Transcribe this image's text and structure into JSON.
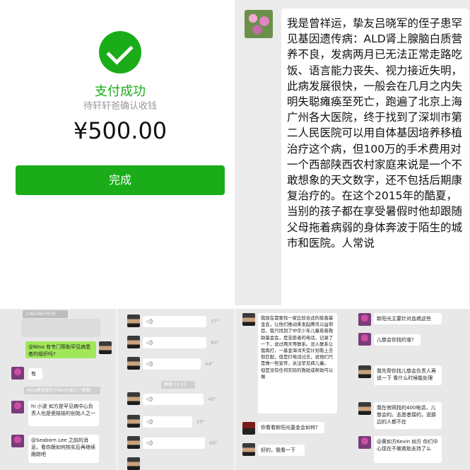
{
  "payment": {
    "title": "支付成功",
    "subtitle": "待轩轩爸确认收钱",
    "amount": "¥500.00",
    "done_label": "完成",
    "accent": "#1aad19"
  },
  "story": {
    "text": "我是曾祥运，挚友吕晓军的侄子患罕见基因遗传病：ALD肾上腺脑白质营养不良，发病两月已无法正常走路吃饭、语言能力丧失、视力接近失明，此病发展很快，一般会在几月之内失明失聪瘫痪至死亡，跑遍了北京上海广州各大医院，终于找到了深圳市第二人民医院可以用自体基因培养移植治疗这个病，但100万的手术费用对一个西部陕西农村家庭来说是一个不敢想象的天文数字，还不包括后期康复治疗的。在这个2015年的酷夏，当别的孩子都在享受暑假时他却跟随父母拖着病弱的身体奔波于陌生的城市和医院。人常说"
  },
  "shot1": {
    "top_number": "13623607679",
    "bubble1": "@Nina 有专门帮助罕见病患者的组织吗?",
    "bubble2": "有",
    "system": "Nina邀请黄轩兰Kevin加入了群聊",
    "bubble3": "hi 小波 如方是罕见病中心负责人也是瓷娃娃的创始人之一",
    "bubble4": "@Seaborn Lee 之前的消息，看你跟如何核实后再继续跟踪吧"
  },
  "shot2": {
    "durations": [
      "57\"",
      "60\"",
      "44\"",
      "48\"",
      "29\"",
      "49\""
    ],
    "system": "晚晚 11:01"
  },
  "shot3": {
    "bubble1": "我现在需要找一家比较合适的慈善基金会，让他们推动来发起腾讯公益项目，我只找到了中华少年儿童慈善救助基金会，是志愿者的电话，记录了一下，说过两天等联系。没人联系让我再打，一基金海洋天堂计划看上去很匹配，但是打电话过去，说他们只是做一些宣传，关注罕见病儿童。 但是没有任何实际的救助或帮助可以做",
    "bubble2": "你看看新阳光基金会如何?",
    "bubble3": "好的，我看一下"
  },
  "shot4": {
    "bubble1": "新阳光主要针对血癌这些",
    "bubble2": "儿慈会你找的谁?",
    "bubble3": "我先帮你找儿慈会负责人再说一下 看什么时候能处理",
    "bubble4": "我在官网找的400电话，儿慈会的。志愿者接的，说那边的人都不在",
    "bubble5": "@黄如方Kevin 如方 你们中心现在不做救助支持了么"
  }
}
